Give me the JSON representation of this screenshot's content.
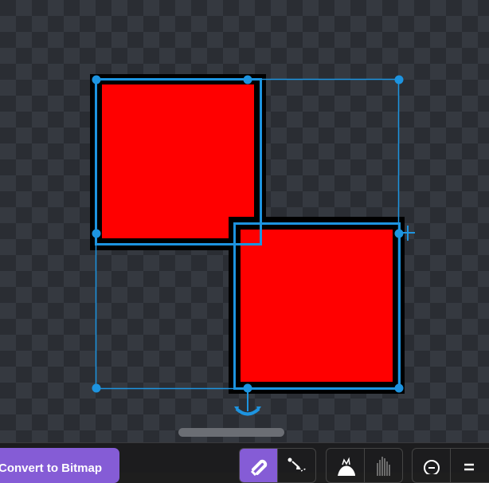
{
  "canvas": {
    "fill_color": "#ff0000",
    "outline_color": "#000000",
    "selection_color": "#1d94e0",
    "scrollbar_color": "#6b6e74"
  },
  "toolbar": {
    "convert_label": "Convert to Bitmap",
    "convert_color": "#855cd6",
    "buttons": [
      {
        "icon": "magnet-icon",
        "active": true
      },
      {
        "icon": "pointer-curve-icon",
        "active": false
      },
      {
        "icon": "brush-icon",
        "active": false
      },
      {
        "icon": "eraser-lines-icon",
        "active": false
      },
      {
        "icon": "zoom-out-icon",
        "active": false
      },
      {
        "icon": "zoom-reset-icon",
        "active": false
      }
    ]
  }
}
